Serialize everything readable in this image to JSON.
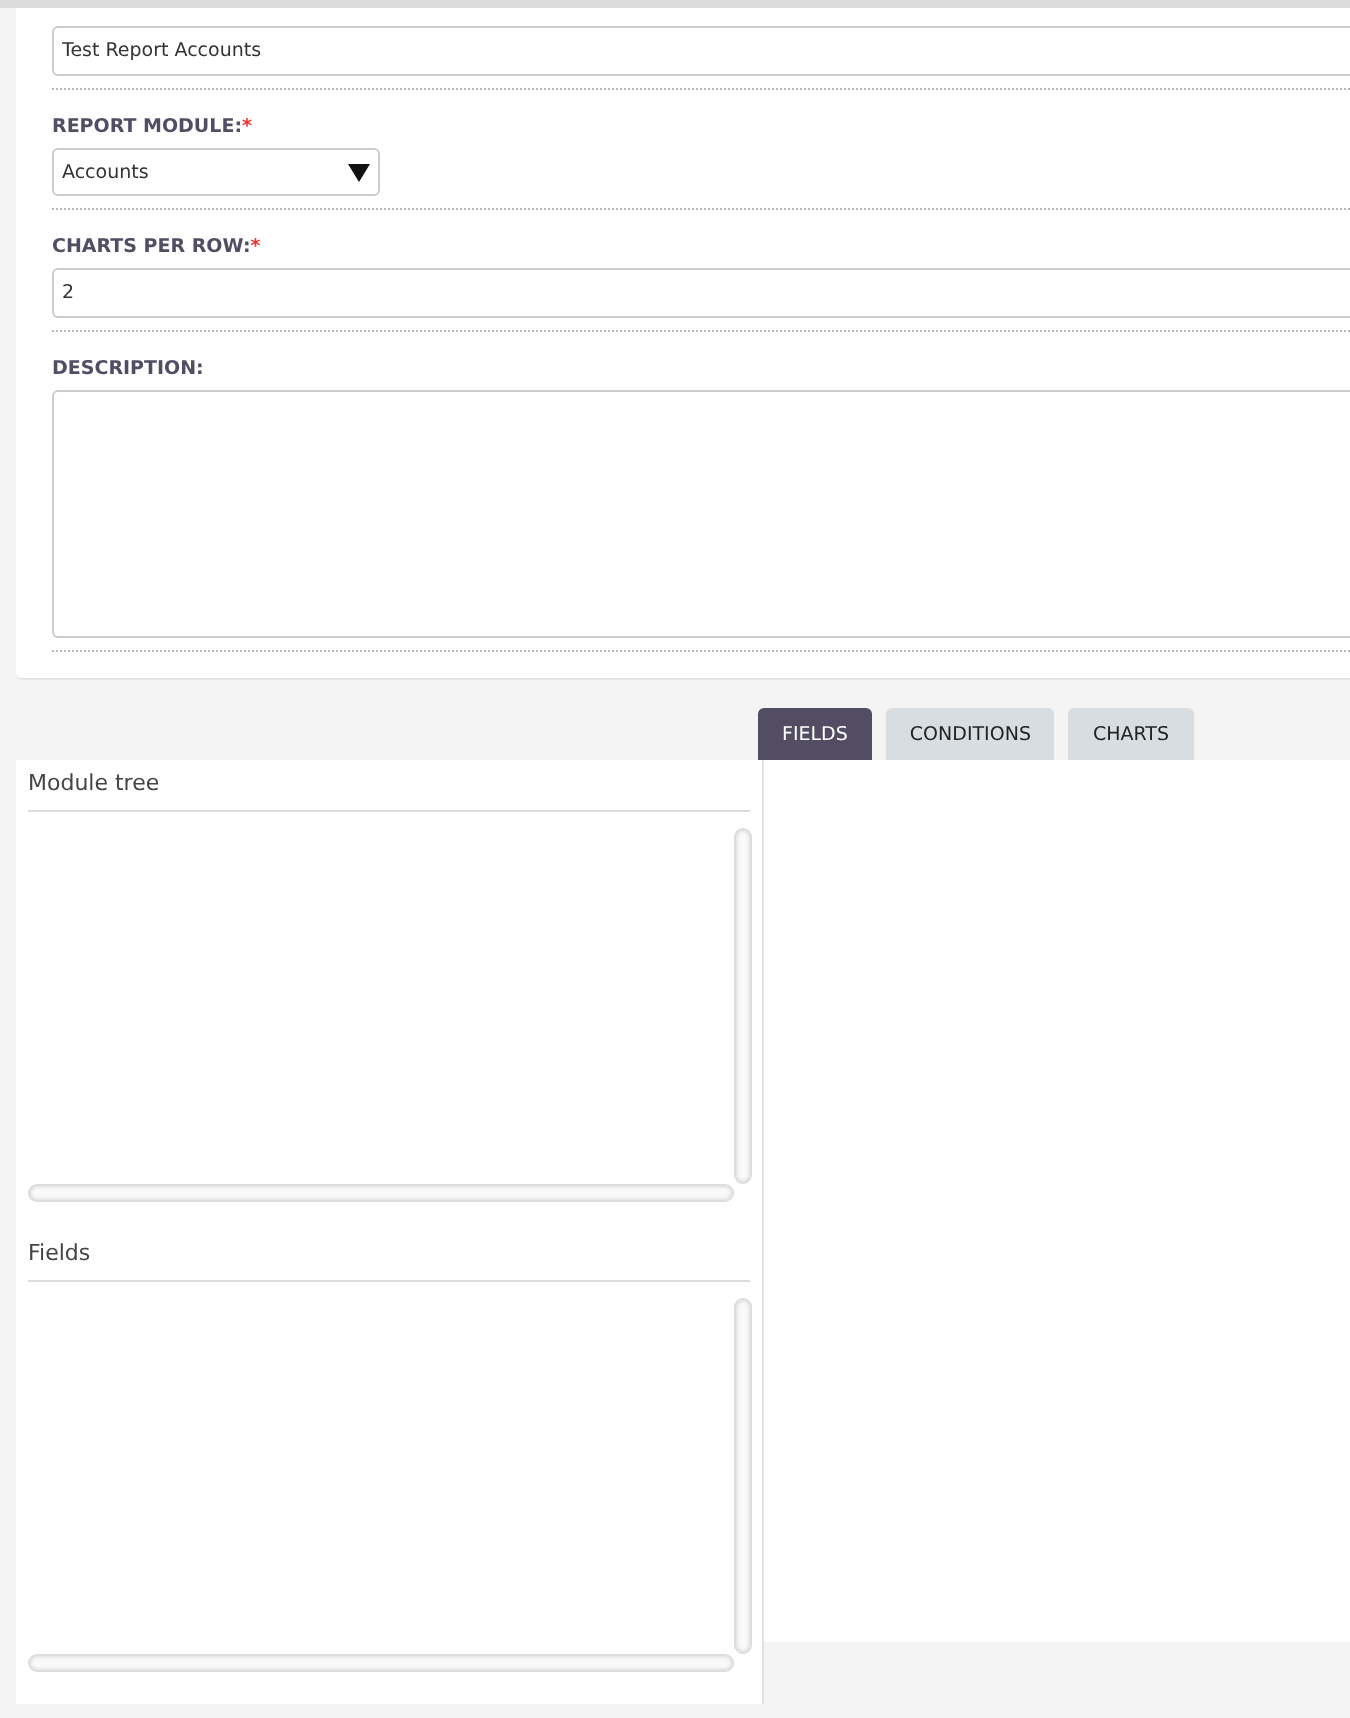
{
  "form": {
    "required_mark": "*",
    "fields": [
      {
        "kind": "text",
        "value": "Test Report Accounts"
      },
      {
        "kind": "select",
        "label": "REPORT MODULE:",
        "required": true,
        "value": "Accounts"
      },
      {
        "kind": "text",
        "label": "CHARTS PER ROW:",
        "required": true,
        "value": "2"
      },
      {
        "kind": "textarea",
        "label": "DESCRIPTION:"
      }
    ]
  },
  "tabs": [
    {
      "label": "FIELDS",
      "selected": true
    },
    {
      "label": "CONDITIONS",
      "selected": false
    },
    {
      "label": "CHARTS",
      "selected": false
    }
  ],
  "left_panel": {
    "sections": [
      {
        "title": "Module tree"
      },
      {
        "title": "Fields"
      }
    ]
  }
}
